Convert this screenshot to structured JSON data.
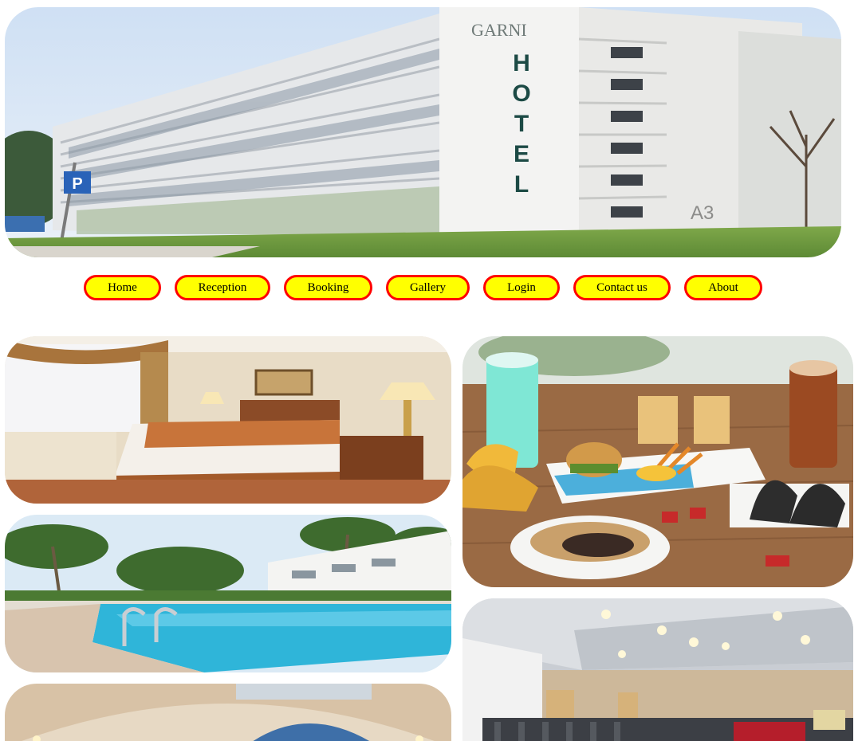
{
  "hero": {
    "image": "hotel-building-photo",
    "sign_top": "GARNI",
    "sign_vertical": "HOTEL",
    "building_code": "A3",
    "parking_sign": "P"
  },
  "nav": {
    "items": [
      {
        "label": "Home"
      },
      {
        "label": "Reception"
      },
      {
        "label": "Booking"
      },
      {
        "label": "Gallery"
      },
      {
        "label": "Login"
      },
      {
        "label": "Contact us"
      },
      {
        "label": "About"
      }
    ],
    "colors": {
      "background": "#ffff00",
      "border": "#ff0000",
      "text": "#000000"
    }
  },
  "gallery": {
    "tiles": [
      {
        "image": "hotel-bedroom-photo"
      },
      {
        "image": "swimming-pool-photo"
      },
      {
        "image": "dome-hall-photo"
      },
      {
        "image": "food-platter-photo"
      },
      {
        "image": "conference-room-photo"
      }
    ]
  }
}
